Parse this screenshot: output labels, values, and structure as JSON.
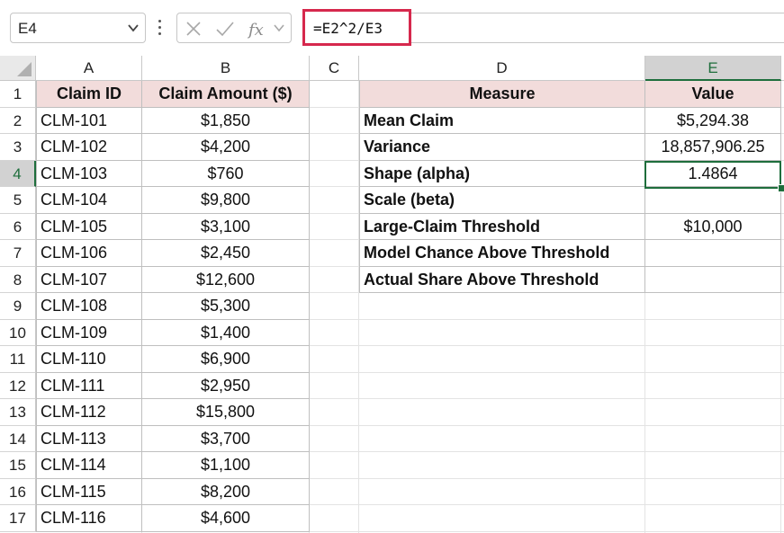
{
  "name_box": {
    "value": "E4",
    "dropdown_icon": "chevron-down-icon"
  },
  "formula_bar": {
    "formula": "=E2^2/E3",
    "icons": [
      "cancel-x-icon",
      "confirm-check-icon",
      "fx-icon",
      "chevron-down-icon"
    ]
  },
  "columns": [
    "A",
    "B",
    "C",
    "D",
    "E"
  ],
  "selected_column": "E",
  "rows": [
    "1",
    "2",
    "3",
    "4",
    "5",
    "6",
    "7",
    "8",
    "9",
    "10",
    "11",
    "12",
    "13",
    "14",
    "15",
    "16",
    "17"
  ],
  "selected_row": "4",
  "claims_table": {
    "headers": [
      "Claim ID",
      "Claim Amount ($)"
    ],
    "rows": [
      [
        "CLM-101",
        "$1,850"
      ],
      [
        "CLM-102",
        "$4,200"
      ],
      [
        "CLM-103",
        "$760"
      ],
      [
        "CLM-104",
        "$9,800"
      ],
      [
        "CLM-105",
        "$3,100"
      ],
      [
        "CLM-106",
        "$2,450"
      ],
      [
        "CLM-107",
        "$12,600"
      ],
      [
        "CLM-108",
        "$5,300"
      ],
      [
        "CLM-109",
        "$1,400"
      ],
      [
        "CLM-110",
        "$6,900"
      ],
      [
        "CLM-111",
        "$2,950"
      ],
      [
        "CLM-112",
        "$15,800"
      ],
      [
        "CLM-113",
        "$3,700"
      ],
      [
        "CLM-114",
        "$1,100"
      ],
      [
        "CLM-115",
        "$8,200"
      ],
      [
        "CLM-116",
        "$4,600"
      ]
    ]
  },
  "measures_table": {
    "headers": [
      "Measure",
      "Value"
    ],
    "rows": [
      [
        "Mean Claim",
        "$5,294.38"
      ],
      [
        "Variance",
        "18,857,906.25"
      ],
      [
        "Shape (alpha)",
        "1.4864"
      ],
      [
        "Scale (beta)",
        ""
      ],
      [
        "Large-Claim Threshold",
        "$10,000"
      ],
      [
        "Model Chance Above Threshold",
        ""
      ],
      [
        "Actual Share Above Threshold",
        ""
      ]
    ]
  },
  "colors": {
    "header_fill": "#f2dcdb",
    "selection": "#1e6e3c",
    "formula_highlight": "#d6284d"
  }
}
